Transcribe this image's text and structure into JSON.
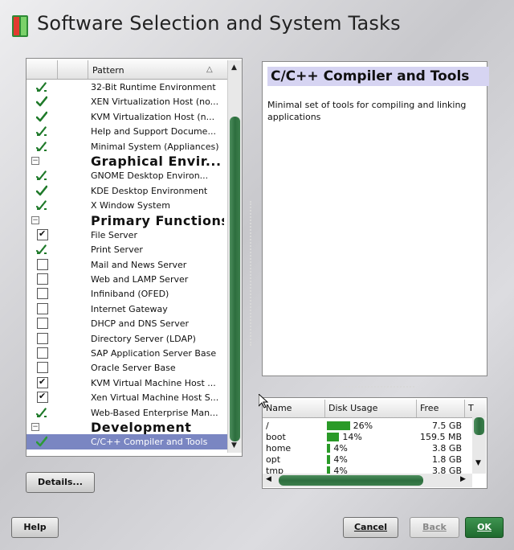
{
  "title": "Software Selection and System Tasks",
  "pattern_list": {
    "header": "Pattern",
    "rows": [
      {
        "type": "item",
        "label": "32-Bit Runtime Environment",
        "state": "auto"
      },
      {
        "type": "item",
        "label": "XEN Virtualization Host (no...",
        "state": "install"
      },
      {
        "type": "item",
        "label": "KVM Virtualization Host (n...",
        "state": "install"
      },
      {
        "type": "item",
        "label": "Help and Support Docume...",
        "state": "auto"
      },
      {
        "type": "item",
        "label": "Minimal System (Appliances)",
        "state": "auto"
      },
      {
        "type": "group",
        "label": "Graphical Envir..."
      },
      {
        "type": "item",
        "label": "GNOME Desktop Environ...",
        "state": "auto"
      },
      {
        "type": "item",
        "label": "KDE Desktop Environment",
        "state": "install"
      },
      {
        "type": "item",
        "label": "X Window System",
        "state": "auto"
      },
      {
        "type": "group",
        "label": "Primary Functions"
      },
      {
        "type": "item",
        "label": "File Server",
        "state": "checked"
      },
      {
        "type": "item",
        "label": "Print Server",
        "state": "auto"
      },
      {
        "type": "item",
        "label": "Mail and News Server",
        "state": "empty"
      },
      {
        "type": "item",
        "label": "Web and LAMP Server",
        "state": "empty"
      },
      {
        "type": "item",
        "label": "Infiniband (OFED)",
        "state": "empty"
      },
      {
        "type": "item",
        "label": "Internet Gateway",
        "state": "empty"
      },
      {
        "type": "item",
        "label": "DHCP and DNS Server",
        "state": "empty"
      },
      {
        "type": "item",
        "label": "Directory Server (LDAP)",
        "state": "empty"
      },
      {
        "type": "item",
        "label": "SAP Application Server Base",
        "state": "empty"
      },
      {
        "type": "item",
        "label": "Oracle Server Base",
        "state": "empty"
      },
      {
        "type": "item",
        "label": "KVM Virtual Machine Host ...",
        "state": "checked"
      },
      {
        "type": "item",
        "label": "Xen Virtual Machine Host S...",
        "state": "checked"
      },
      {
        "type": "item",
        "label": "Web-Based Enterprise Man...",
        "state": "auto"
      },
      {
        "type": "group",
        "label": "Development"
      },
      {
        "type": "item",
        "label": "C/C++ Compiler and Tools",
        "state": "install",
        "selected": true
      }
    ]
  },
  "description": {
    "title": "C/C++ Compiler and Tools",
    "text": "Minimal set of tools for compiling and linking applications"
  },
  "disk_usage": {
    "headers": [
      "Name",
      "Disk Usage",
      "Free",
      "T"
    ],
    "rows": [
      {
        "name": "/",
        "usage_pct": 26,
        "usage_label": "26%",
        "free": "7.5 GB"
      },
      {
        "name": "boot",
        "usage_pct": 14,
        "usage_label": "14%",
        "free": "159.5 MB"
      },
      {
        "name": "home",
        "usage_pct": 4,
        "usage_label": "4%",
        "free": "3.8 GB"
      },
      {
        "name": "opt",
        "usage_pct": 4,
        "usage_label": "4%",
        "free": "1.8 GB"
      },
      {
        "name": "tmp",
        "usage_pct": 4,
        "usage_label": "4%",
        "free": "3.8 GB"
      }
    ]
  },
  "buttons": {
    "details": "Details...",
    "help": "Help",
    "cancel": "Cancel",
    "back": "Back",
    "ok": "OK"
  },
  "colors": {
    "accent_green": "#1f6a2e",
    "selection": "#7a86c2",
    "description_title_bg": "#d6d4f2"
  }
}
